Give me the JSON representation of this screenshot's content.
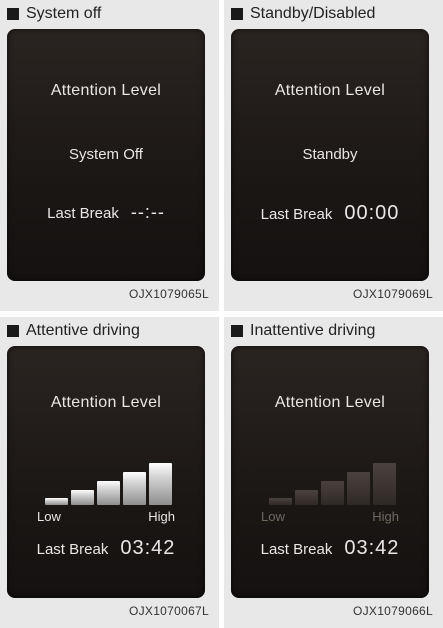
{
  "panels": [
    {
      "header": "System off",
      "title": "Attention Level",
      "status": "System Off",
      "last_break_label": "Last Break",
      "last_break_value": "--:--",
      "code": "OJX1079065L"
    },
    {
      "header": "Standby/Disabled",
      "title": "Attention Level",
      "status": "Standby",
      "last_break_label": "Last Break",
      "last_break_value": "00:00",
      "code": "OJX1079069L"
    },
    {
      "header": "Attentive driving",
      "title": "Attention Level",
      "scale_low": "Low",
      "scale_high": "High",
      "level": 5,
      "level_max": 5,
      "last_break_label": "Last Break",
      "last_break_value": "03:42",
      "code": "OJX1070067L"
    },
    {
      "header": "Inattentive driving",
      "title": "Attention Level",
      "scale_low": "Low",
      "scale_high": "High",
      "level": 0,
      "level_max": 5,
      "last_break_label": "Last Break",
      "last_break_value": "03:42",
      "code": "OJX1079066L"
    }
  ]
}
